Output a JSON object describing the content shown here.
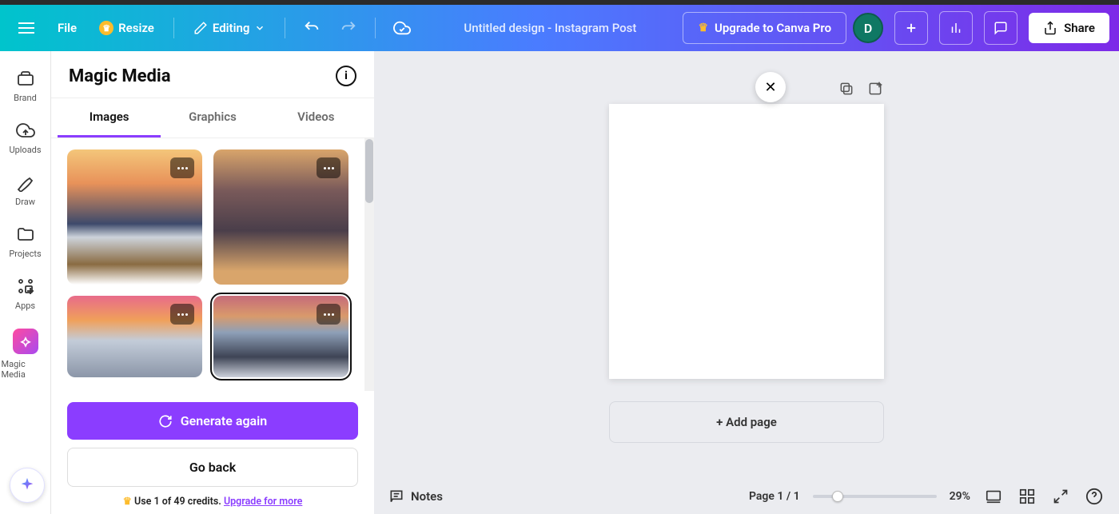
{
  "header": {
    "file": "File",
    "resize": "Resize",
    "editing": "Editing",
    "doc_title": "Untitled design - Instagram Post",
    "upgrade": "Upgrade to Canva Pro",
    "avatar_initial": "D",
    "share": "Share"
  },
  "rail": {
    "brand": "Brand",
    "uploads": "Uploads",
    "draw": "Draw",
    "projects": "Projects",
    "apps": "Apps",
    "magic": "Magic Media"
  },
  "panel": {
    "title": "Magic Media",
    "tabs": {
      "images": "Images",
      "graphics": "Graphics",
      "videos": "Videos"
    },
    "generate": "Generate again",
    "goback": "Go back",
    "credits_prefix": "Use 1 of 49 credits. ",
    "credits_link": "Upgrade for more"
  },
  "canvas": {
    "add_page": "+ Add page"
  },
  "bottom": {
    "notes": "Notes",
    "page": "Page 1 / 1",
    "zoom": "29%"
  }
}
